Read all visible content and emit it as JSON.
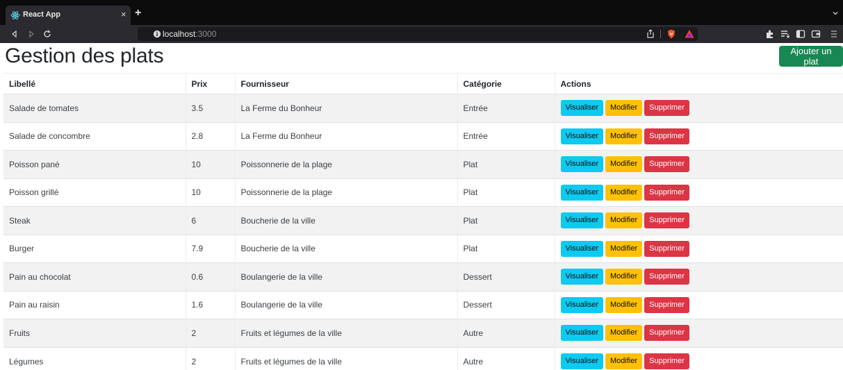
{
  "browser": {
    "tab_title": "React App",
    "tab_close": "×",
    "new_tab": "+",
    "url_host": "localhost",
    "url_port": ":3000"
  },
  "page": {
    "title": "Gestion des plats",
    "add_button": "Ajouter un plat"
  },
  "table": {
    "headers": [
      "Libellé",
      "Prix",
      "Fournisseur",
      "Catégorie",
      "Actions"
    ],
    "action_labels": {
      "view": "Visualiser",
      "edit": "Modifier",
      "delete": "Supprimer"
    },
    "rows": [
      {
        "libelle": "Salade de tomates",
        "prix": "3.5",
        "fournisseur": "La Ferme du Bonheur",
        "categorie": "Entrée"
      },
      {
        "libelle": "Salade de concombre",
        "prix": "2.8",
        "fournisseur": "La Ferme du Bonheur",
        "categorie": "Entrée"
      },
      {
        "libelle": "Poisson pané",
        "prix": "10",
        "fournisseur": "Poissonnerie de la plage",
        "categorie": "Plat"
      },
      {
        "libelle": "Poisson grillé",
        "prix": "10",
        "fournisseur": "Poissonnerie de la plage",
        "categorie": "Plat"
      },
      {
        "libelle": "Steak",
        "prix": "6",
        "fournisseur": "Boucherie de la ville",
        "categorie": "Plat"
      },
      {
        "libelle": "Burger",
        "prix": "7.9",
        "fournisseur": "Boucherie de la ville",
        "categorie": "Plat"
      },
      {
        "libelle": "Pain au chocolat",
        "prix": "0.6",
        "fournisseur": "Boulangerie de la ville",
        "categorie": "Dessert"
      },
      {
        "libelle": "Pain au raisin",
        "prix": "1.6",
        "fournisseur": "Boulangerie de la ville",
        "categorie": "Dessert"
      },
      {
        "libelle": "Fruits",
        "prix": "2",
        "fournisseur": "Fruits et légumes de la ville",
        "categorie": "Autre"
      },
      {
        "libelle": "Légumes",
        "prix": "2",
        "fournisseur": "Fruits et légumes de la ville",
        "categorie": "Autre"
      }
    ]
  },
  "colors": {
    "primary_add": "#198754",
    "view": "#0dcaf0",
    "edit": "#ffc107",
    "delete": "#dc3545",
    "stripe": "#f2f2f2"
  },
  "icons": [
    "react-icon",
    "back-icon",
    "forward-icon",
    "reload-icon",
    "bookmark-icon",
    "info-icon",
    "share-icon",
    "brave-shield-icon",
    "brave-rewards-icon",
    "extensions-icon",
    "playlist-icon",
    "sidebar-icon",
    "wallet-icon",
    "menu-icon",
    "tab-list-icon"
  ]
}
